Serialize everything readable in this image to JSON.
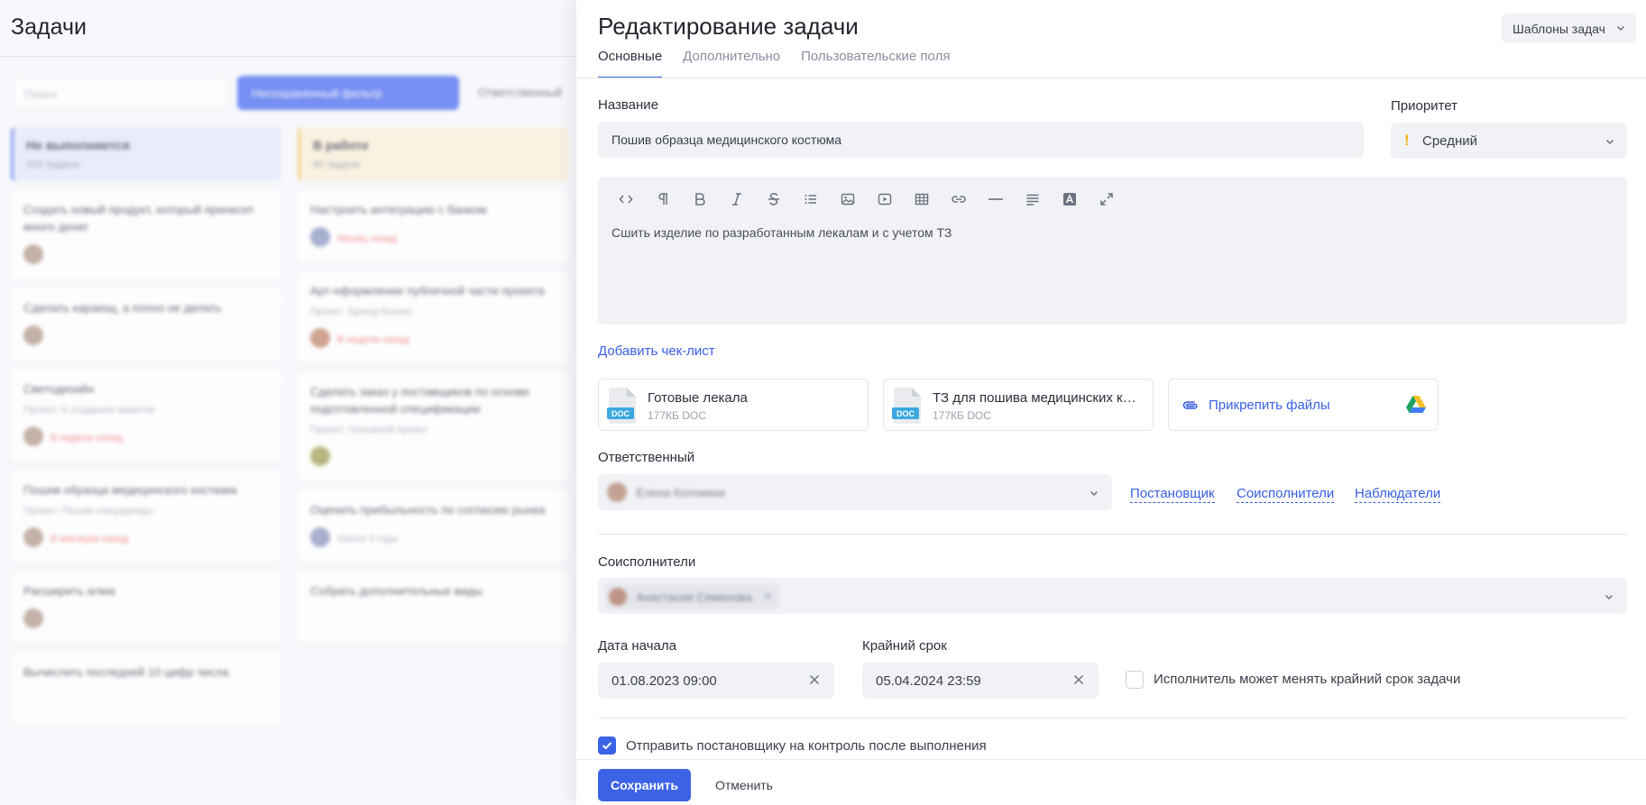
{
  "board": {
    "title": "Задачи",
    "search_placeholder": "Поиск",
    "filter_label": "Несохраненный фильтр",
    "responsible_label": "Ответственный",
    "columns": [
      {
        "title": "Не выполняется",
        "count": "203 Задачи",
        "color": "#e4e9fb",
        "bar": "#5a79ea",
        "cards": [
          {
            "title": "Создать новый продукт, который принесет много денег",
            "sub": ""
          },
          {
            "title": "Сделать карающ, а плохо не делать",
            "sub": ""
          },
          {
            "title": "Светодизайн",
            "sub": "Проект: К созданию макетов",
            "late": "В недели назад"
          },
          {
            "title": "Пошив образца медицинского костюма",
            "sub": "Проект: Пошив спецодежды",
            "late": "В месяцев назад"
          },
          {
            "title": "Расширить алма",
            "sub": ""
          },
          {
            "title": "Вычислить последней 10 цифр числа",
            "sub": ""
          }
        ]
      },
      {
        "title": "В работе",
        "count": "90 Задачи",
        "color": "#fbf0d8",
        "bar": "#f1c454",
        "cards": [
          {
            "title": "Настроить интеграцию с банком",
            "sub": "",
            "late": "Месяц назад"
          },
          {
            "title": "Арт-оформление публичной части проекта",
            "sub": "Проект: Бренд-бизнес",
            "late": "В недели назад"
          },
          {
            "title": "Сделать заказ у поставщиков по основе подготовленной спецификации",
            "sub": "Проект: Основной проект",
            "late": ""
          },
          {
            "title": "Оценить прибыльность по согласию рынка",
            "sub": "",
            "late": "Около 3 года"
          },
          {
            "title": "Собрать дополнительные виды",
            "sub": ""
          }
        ]
      }
    ]
  },
  "panel": {
    "title": "Редактирование задачи",
    "templates_button": "Шаблоны задач",
    "tabs": [
      "Основные",
      "Дополнительно",
      "Пользовательские поля"
    ],
    "name_label": "Название",
    "name_value": "Пошив образца медицинского костюма",
    "priority_label": "Приоритет",
    "priority_value": "Средний",
    "priority_color": "#f2b51a",
    "editor_text": "Сшить изделие по разработанным лекалам и с учетом ТЗ",
    "toolbar_icons": [
      "code-icon",
      "paragraph-icon",
      "bold-icon",
      "italic-icon",
      "strikethrough-icon",
      "list-icon",
      "image-icon",
      "video-icon",
      "table-icon",
      "link-icon",
      "hr-icon",
      "align-icon",
      "font-color-icon",
      "fullscreen-icon"
    ],
    "add_checklist": "Добавить чек-лист",
    "files": [
      {
        "name": "Готовые лекала",
        "size": "177КБ DOC",
        "ext": "DOC"
      },
      {
        "name": "ТЗ для пошива медицинских костюмов",
        "size": "177КБ DOC",
        "ext": "DOC"
      }
    ],
    "attach_label": "Прикрепить файлы",
    "responsible_label": "Ответственный",
    "responsible_value": "Елена Колокина",
    "role_links": [
      "Постановщик",
      "Соисполнители",
      "Наблюдатели"
    ],
    "coexec_label": "Соисполнители",
    "coexec_value": "Анастасия Семенова",
    "start_label": "Дата начала",
    "start_value": "01.08.2023 09:00",
    "deadline_label": "Крайний срок",
    "deadline_value": "05.04.2024 23:59",
    "can_change_deadline": "Исполнитель может менять крайний срок задачи",
    "send_control": "Отправить постановщику на контроль после выполнения",
    "save": "Сохранить",
    "cancel": "Отменить",
    "accent": "#3c63e6"
  }
}
